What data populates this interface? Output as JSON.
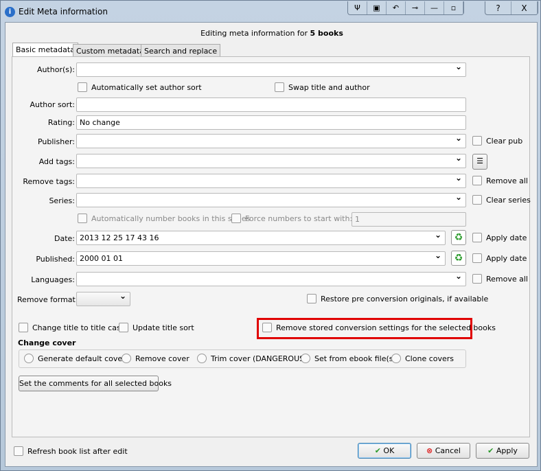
{
  "window": {
    "title": "Edit Meta information",
    "buttons": [
      "Ψ",
      "▣",
      "↶",
      "⊸",
      "—",
      "▫"
    ],
    "help": "?",
    "close": "X"
  },
  "heading": {
    "prefix": "Editing meta information for ",
    "count": "5 books"
  },
  "tabs": [
    "Basic metadata",
    "Custom metadata",
    "Search and replace"
  ],
  "form": {
    "authors_label": "Author(s):",
    "authors_value": "",
    "auto_author_sort": "Automatically set author sort",
    "swap_title": "Swap title and author",
    "author_sort_label": "Author sort:",
    "rating_label": "Rating:",
    "rating_value": "No change",
    "publisher_label": "Publisher:",
    "clear_pub": "Clear pub",
    "add_tags_label": "Add tags:",
    "remove_tags_label": "Remove tags:",
    "remove_all_tags": "Remove all",
    "series_label": "Series:",
    "clear_series": "Clear series",
    "auto_number": "Automatically number books in this series",
    "force_numbers": "Force numbers to start with:",
    "force_value": "1",
    "date_label": "Date:",
    "date_value": "2013 12 25 17 43 16",
    "apply_date": "Apply date",
    "published_label": "Published:",
    "published_value": "2000 01 01",
    "apply_published": "Apply date",
    "languages_label": "Languages:",
    "remove_all_langs": "Remove all",
    "remove_format_label": "Remove format:",
    "restore_pre": "Restore pre conversion originals, if available",
    "title_case": "Change title to title case",
    "update_title_sort": "Update title sort",
    "remove_conversion": "Remove stored conversion settings for the selected books"
  },
  "cover": {
    "heading": "Change cover",
    "options": [
      "Generate default cover",
      "Remove cover",
      "Trim cover (DANGEROUS)",
      "Set from ebook file(s)",
      "Clone covers"
    ]
  },
  "comments_button": "Set the comments for all selected books",
  "footer": {
    "refresh": "Refresh book list after edit",
    "ok": "OK",
    "cancel": "Cancel",
    "apply": "Apply"
  },
  "colors": {
    "highlight": "#e00000"
  }
}
